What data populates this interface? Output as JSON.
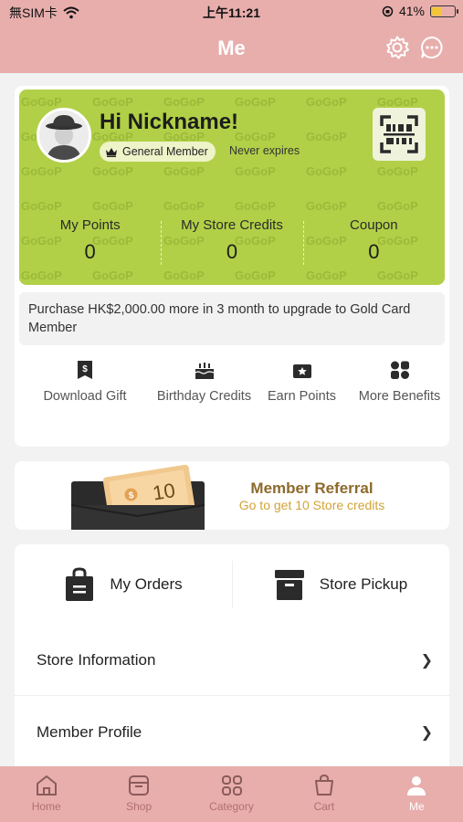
{
  "status_bar": {
    "carrier": "無SIM卡",
    "time": "上午11:21",
    "battery_percent": "41%",
    "battery_level": 0.41
  },
  "header": {
    "title": "Me"
  },
  "member": {
    "greeting": "Hi Nickname!",
    "tier": "General Member",
    "expiry": "Never expires",
    "pattern_text": "GoGoP",
    "stats": [
      {
        "label": "My Points",
        "value": "0"
      },
      {
        "label": "My Store Credits",
        "value": "0"
      },
      {
        "label": "Coupon",
        "value": "0"
      }
    ],
    "upgrade_message": "Purchase HK$2,000.00 more in 3 month to upgrade to Gold Card Member"
  },
  "benefits": [
    {
      "label": "Download Gift",
      "icon": "gift-coupon-icon"
    },
    {
      "label": "Birthday Credits",
      "icon": "birthday-cake-icon"
    },
    {
      "label": "Earn Points",
      "icon": "earn-points-icon"
    },
    {
      "label": "More Benefits",
      "icon": "benefits-grid-icon"
    }
  ],
  "referral": {
    "title": "Member Referral",
    "subtitle": "Go to get 10 Store credits",
    "ticket_value": "10"
  },
  "orders": {
    "my_orders": "My Orders",
    "store_pickup": "Store Pickup"
  },
  "menu": [
    {
      "label": "Store Information"
    },
    {
      "label": "Member Profile"
    }
  ],
  "tabbar": [
    {
      "label": "Home",
      "icon": "home-icon"
    },
    {
      "label": "Shop",
      "icon": "shop-icon"
    },
    {
      "label": "Category",
      "icon": "category-icon"
    },
    {
      "label": "Cart",
      "icon": "cart-icon"
    },
    {
      "label": "Me",
      "icon": "person-icon",
      "active": true
    }
  ],
  "colors": {
    "header": "#e8aeac",
    "member_card": "#b1d047",
    "referral_title": "#8d6a2c",
    "referral_subtitle": "#d2a339"
  }
}
